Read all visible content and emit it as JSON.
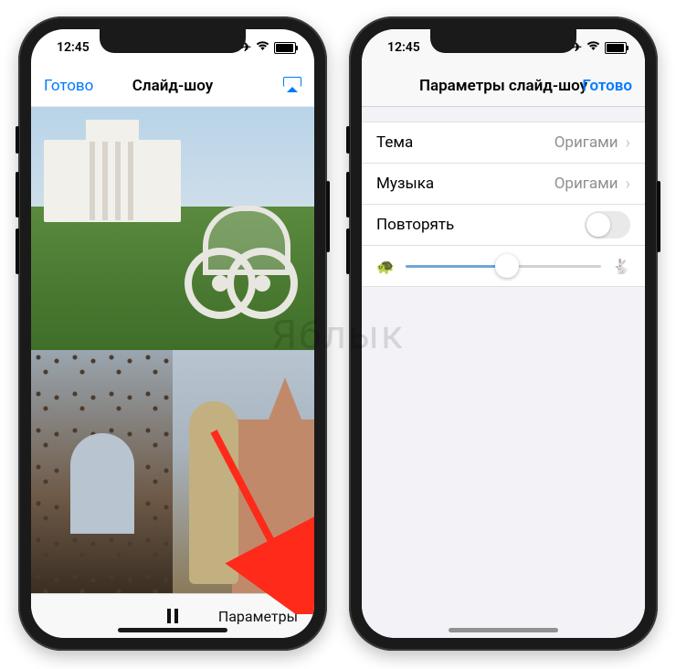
{
  "watermark": "Яблык",
  "statusbar": {
    "time": "12:45"
  },
  "left_screen": {
    "nav": {
      "left": "Готово",
      "title": "Слайд-шоу"
    },
    "toolbar": {
      "options": "Параметры"
    }
  },
  "right_screen": {
    "nav": {
      "title": "Параметры слайд-шоу",
      "done": "Готово"
    },
    "rows": {
      "theme_label": "Тема",
      "theme_value": "Оригами",
      "music_label": "Музыка",
      "music_value": "Оригами",
      "repeat_label": "Повторять"
    },
    "slider_percent": 52
  }
}
